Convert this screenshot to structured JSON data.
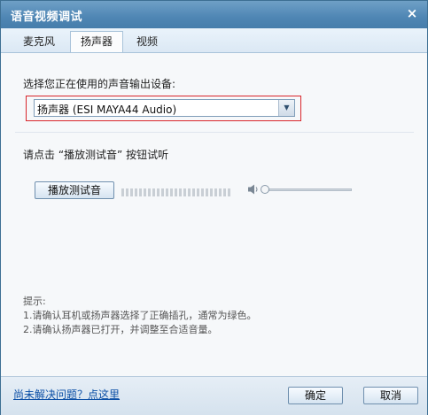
{
  "window": {
    "title": "语音视频调试",
    "close_glyph": "×"
  },
  "tabs": [
    {
      "label": "麦克风",
      "active": false
    },
    {
      "label": "扬声器",
      "active": true
    },
    {
      "label": "视频",
      "active": false
    }
  ],
  "speaker": {
    "device_label": "选择您正在使用的声音输出设备:",
    "device_value": "扬声器 (ESI MAYA44 Audio)",
    "test_instruction": "请点击 “播放测试音” 按钮试听",
    "play_button": "播放测试音",
    "volume_level": 0.0,
    "level_meter": 0.0
  },
  "tips": {
    "heading": "提示:",
    "line1": "1.请确认耳机或扬声器选择了正确插孔，通常为绿色。",
    "line2": "2.请确认扬声器已打开，并调整至合适音量。"
  },
  "footer": {
    "help_link": "尚未解决问题？点这里",
    "ok_button": "确定",
    "cancel_button": "取消"
  },
  "colors": {
    "titlebar": "#4f86b4",
    "highlight_border": "#d8262b",
    "link": "#0b4fa6"
  }
}
